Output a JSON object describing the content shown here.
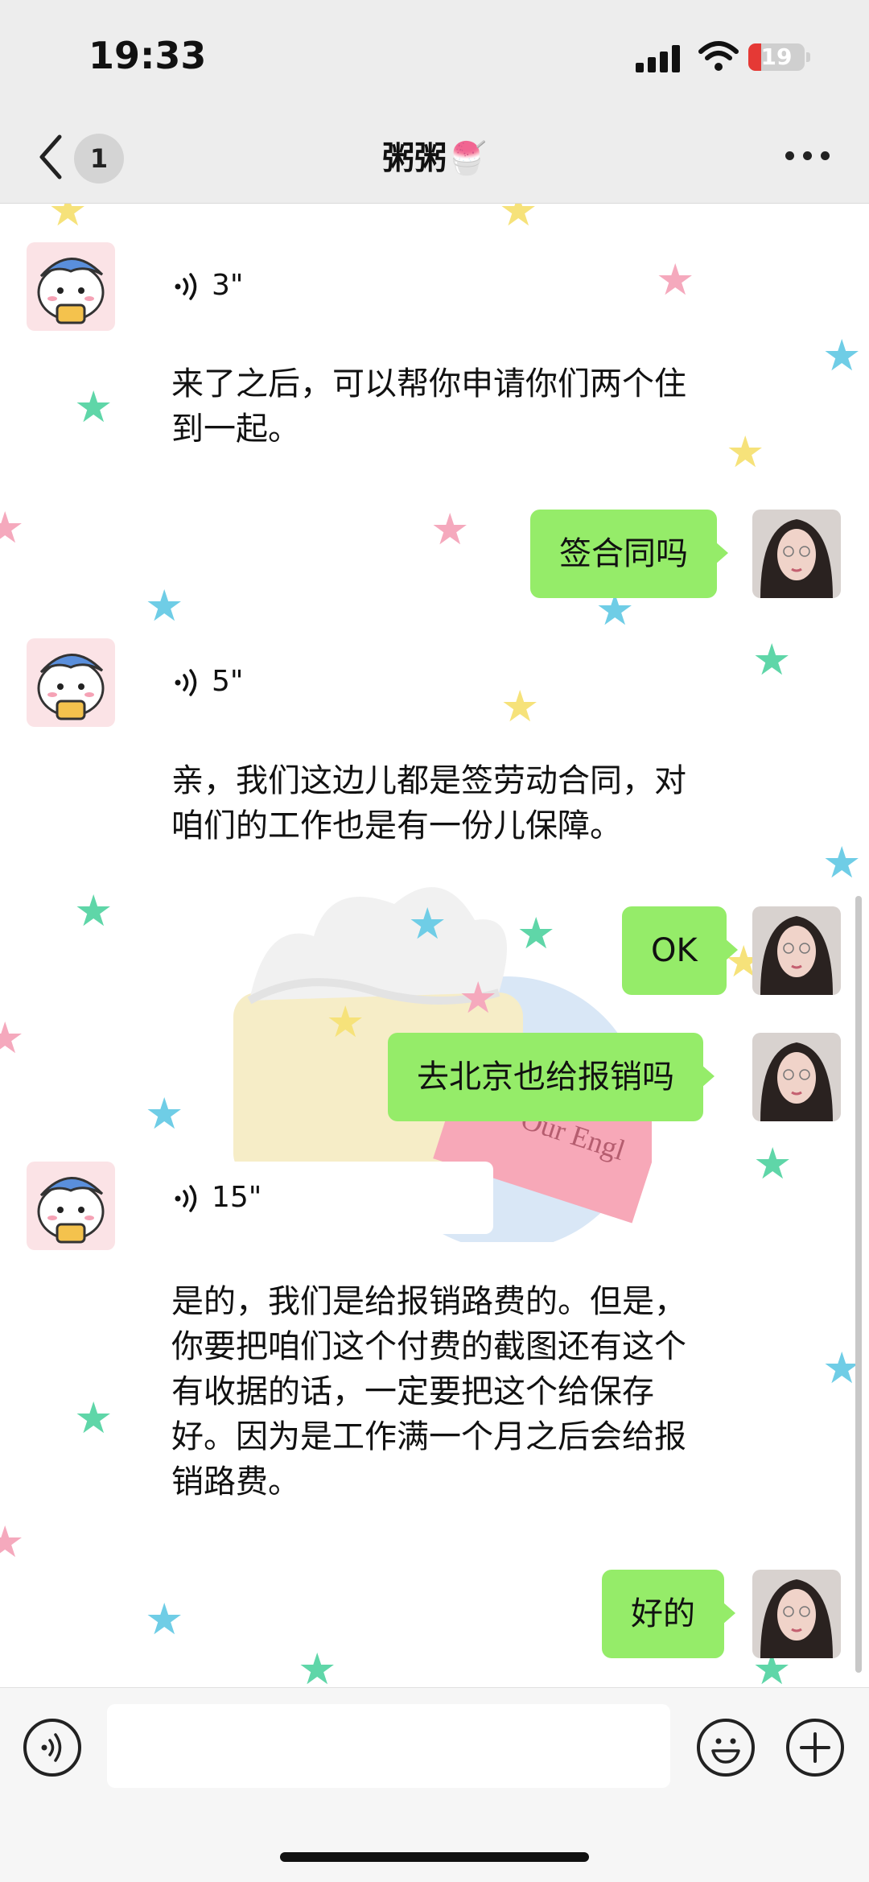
{
  "status_bar": {
    "time": "19:33",
    "battery": "19"
  },
  "header": {
    "back_count": "1",
    "title": "粥粥🍧"
  },
  "messages": [
    {
      "side": "left",
      "type": "voice",
      "duration": "3\""
    },
    {
      "side": "left",
      "type": "text",
      "text": "来了之后，可以帮你申请你们两个住到一起。"
    },
    {
      "side": "right",
      "type": "text",
      "text": "签合同吗"
    },
    {
      "side": "left",
      "type": "voice",
      "duration": "5\""
    },
    {
      "side": "left",
      "type": "text",
      "text": "亲，我们这边儿都是签劳动合同，对咱们的工作也是有一份儿保障。"
    },
    {
      "side": "right",
      "type": "text",
      "text": "OK"
    },
    {
      "side": "right",
      "type": "text",
      "text": "去北京也给报销吗"
    },
    {
      "side": "left",
      "type": "voice",
      "duration": "15\""
    },
    {
      "side": "left",
      "type": "text",
      "text": "是的，我们是给报销路费的。但是，你要把咱们这个付费的截图还有这个有收据的话，一定要把这个给保存好。因为是工作满一个月之后会给报销路费。"
    },
    {
      "side": "right",
      "type": "text",
      "text": "好的"
    }
  ],
  "background": {
    "card_text": "Our Engl"
  },
  "colors": {
    "bubble_sent": "#95ec69",
    "bar_bg": "#ededed"
  },
  "icons": [
    "back-chevron-icon",
    "more-dots-icon",
    "voice-wave-icon",
    "emoji-icon",
    "plus-icon"
  ]
}
